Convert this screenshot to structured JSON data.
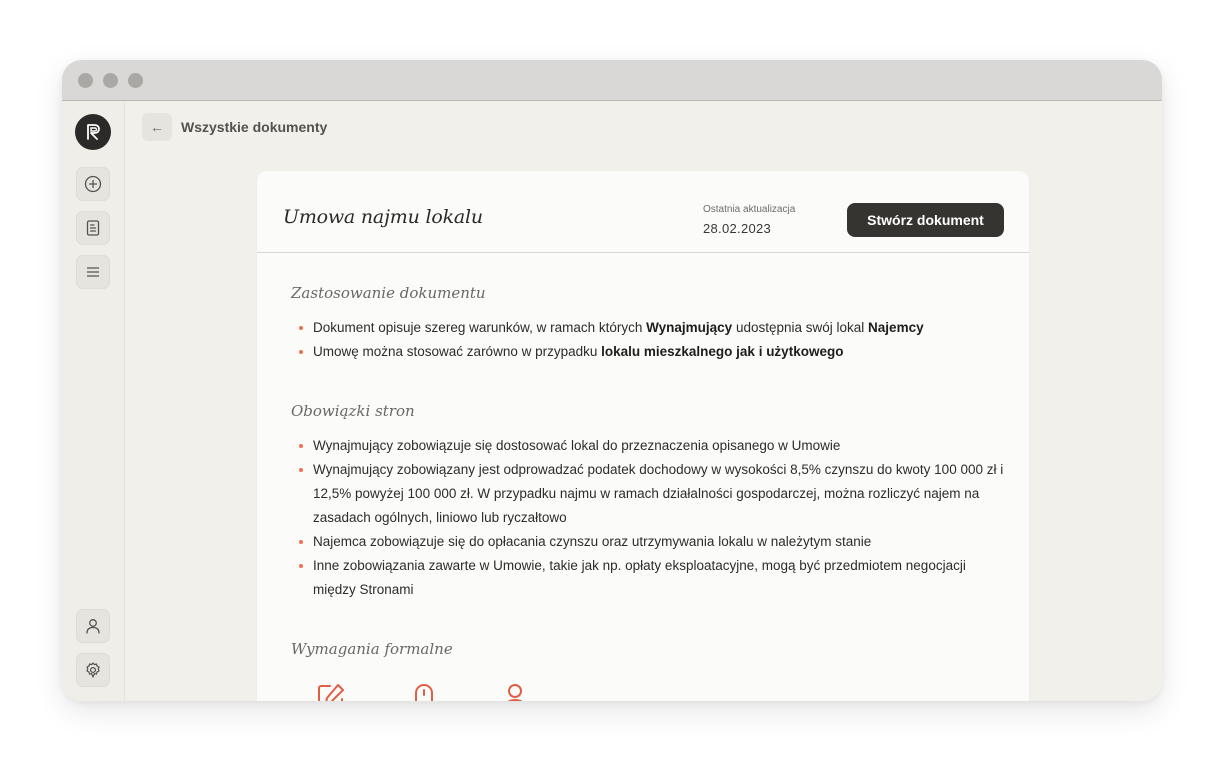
{
  "nav": {
    "back_arrow": "←",
    "breadcrumb": "Wszystkie dokumenty"
  },
  "sidebar": {
    "logo": "logo-icon",
    "items": [
      {
        "icon": "plus-circle-icon"
      },
      {
        "icon": "document-icon"
      },
      {
        "icon": "menu-icon"
      }
    ],
    "bottom": [
      {
        "icon": "user-icon"
      },
      {
        "icon": "settings-icon"
      }
    ]
  },
  "document": {
    "title": "Umowa najmu lokalu",
    "update_label": "Ostatnia aktualizacja",
    "update_date": "28.02.2023",
    "create_button": "Stwórz dokument"
  },
  "sections": [
    {
      "title": "Zastosowanie dokumentu",
      "items": [
        [
          {
            "t": "Dokument opisuje szereg warunków, w ramach których "
          },
          {
            "t": "Wynajmujący",
            "b": true
          },
          {
            "t": " udostępnia swój lokal "
          },
          {
            "t": "Najemcy",
            "b": true
          }
        ],
        [
          {
            "t": "Umowę można stosować zarówno w przypadku "
          },
          {
            "t": "lokalu mieszkalnego jak i użytkowego",
            "b": true
          }
        ]
      ]
    },
    {
      "title": "Obowiązki stron",
      "items": [
        [
          {
            "t": "Wynajmujący zobowiązuje się dostosować lokal do przeznaczenia opisanego w Umowie"
          }
        ],
        [
          {
            "t": "Wynajmujący zobowiązany jest odprowadzać podatek dochodowy w wysokości 8,5% czynszu do kwoty 100 000 zł i 12,5% powyżej 100 000 zł. W przypadku najmu w ramach działalności gospodarczej, można rozliczyć najem na zasadach ogólnych, liniowo lub ryczałtowo"
          }
        ],
        [
          {
            "t": "Najemca zobowiązuje się do opłacania czynszu oraz utrzymywania lokalu w należytym stanie"
          }
        ],
        [
          {
            "t": "Inne zobowiązania zawarte w Umowie, takie jak np. opłaty eksploatacyjne, mogą być przedmiotem negocjacji między Stronami"
          }
        ]
      ]
    },
    {
      "title": "Wymagania formalne",
      "items": []
    }
  ],
  "requirements_icons": [
    "edit-icon",
    "mouse-icon",
    "user-check-icon"
  ],
  "colors": {
    "accent": "#e8734d",
    "button": "#363431",
    "background": "#f1f0ea",
    "card": "#fbfbf9"
  }
}
